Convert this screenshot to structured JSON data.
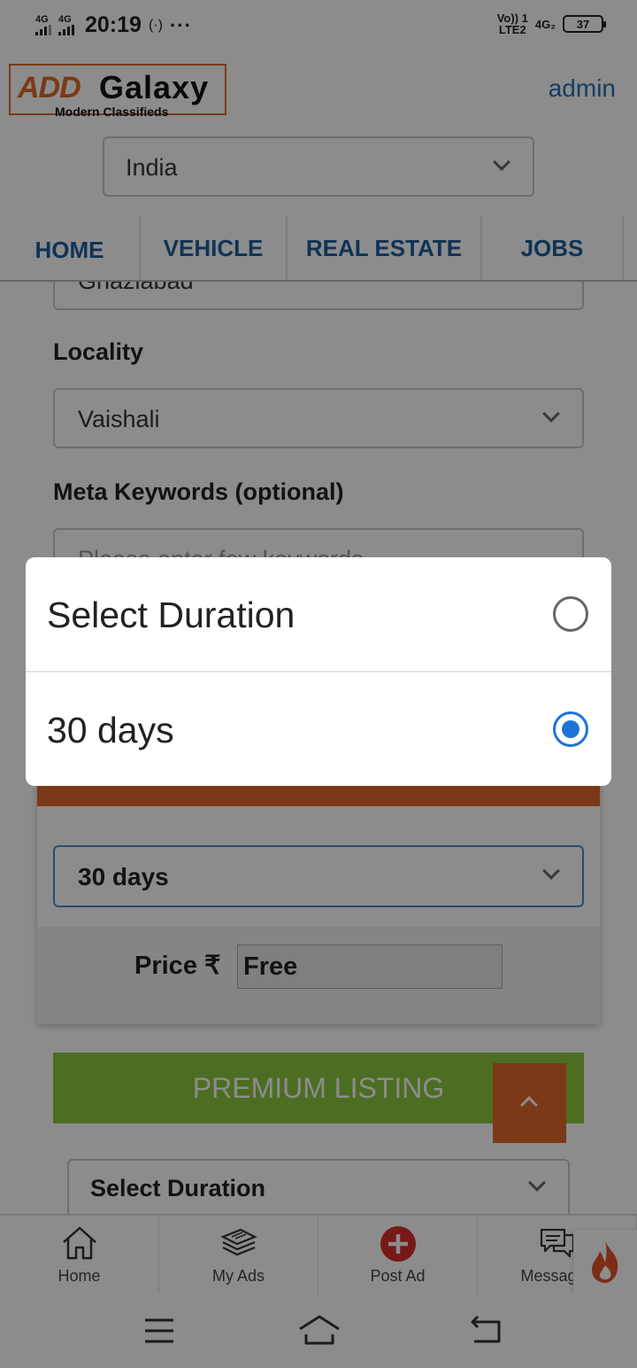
{
  "status_bar": {
    "sim1_network": "4G",
    "sim2_network": "4G",
    "time": "20:19",
    "hotspot": "(·)",
    "more": "···",
    "volte": "Vo)) 1",
    "lte": "LTE2",
    "net_right": "4G₂",
    "battery": "37"
  },
  "header": {
    "logo_add": "ADD",
    "logo_galaxy": "Galaxy",
    "logo_tagline": "Modern Classifieds",
    "admin_link": "admin",
    "country_value": "India"
  },
  "nav": {
    "items": [
      {
        "label": "HOME"
      },
      {
        "label": "VEHICLE"
      },
      {
        "label": "REAL ESTATE"
      },
      {
        "label": "JOBS"
      }
    ]
  },
  "form": {
    "city_value": "Ghaziabad",
    "locality_label": "Locality",
    "locality_value": "Vaishali",
    "meta_label": "Meta Keywords (optional)",
    "meta_placeholder": "Please enter few keywords",
    "duration_value": "30 days",
    "price_label": "Price ₹",
    "price_value": "Free",
    "premium_title": "PREMIUM LISTING",
    "premium_duration": "Select Duration"
  },
  "tabbar": {
    "items": [
      {
        "label": "Home"
      },
      {
        "label": "My Ads"
      },
      {
        "label": "Post Ad"
      },
      {
        "label": "Messages"
      }
    ]
  },
  "dialog": {
    "options": [
      {
        "label": "Select Duration",
        "selected": false
      },
      {
        "label": "30 days",
        "selected": true
      }
    ]
  },
  "colors": {
    "brand_orange": "#e0682a",
    "nav_blue": "#1d5e9c",
    "premium_green": "#8cc63f",
    "radio_blue": "#1e73d8",
    "post_red": "#d9302a"
  }
}
